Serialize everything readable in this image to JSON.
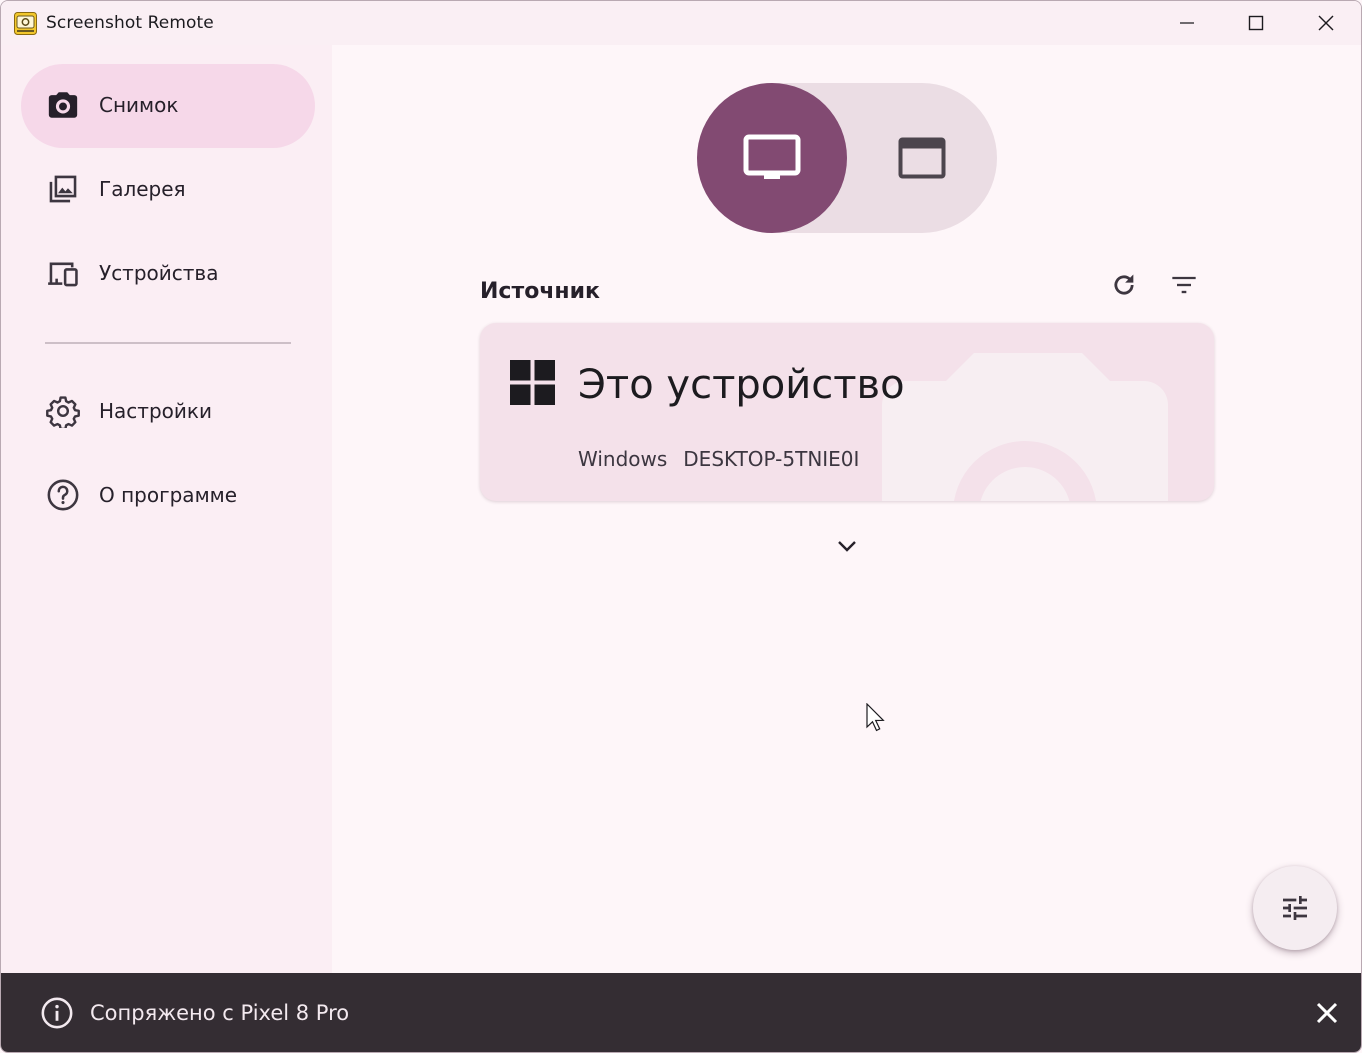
{
  "window": {
    "title": "Screenshot Remote",
    "controls": {
      "minimize": "minimize-icon",
      "maximize": "maximize-icon",
      "close": "close-icon"
    }
  },
  "sidebar": {
    "items": [
      {
        "label": "Снимок",
        "icon": "camera-icon",
        "active": true
      },
      {
        "label": "Галерея",
        "icon": "gallery-icon",
        "active": false
      },
      {
        "label": "Устройства",
        "icon": "devices-icon",
        "active": false
      },
      {
        "label": "Настройки",
        "icon": "gear-icon",
        "active": false
      },
      {
        "label": "О программе",
        "icon": "help-icon",
        "active": false
      }
    ]
  },
  "main": {
    "mode_toggle": {
      "options": [
        "monitor-icon",
        "window-icon"
      ],
      "selected": "monitor-icon"
    },
    "source": {
      "title": "Источник",
      "actions": [
        "refresh-icon",
        "filter-icon"
      ],
      "device": {
        "name": "Это устройство",
        "os": "Windows",
        "hostname": "DESKTOP-5TNIE0I",
        "os_icon": "windows-logo-icon"
      }
    },
    "fab_icon": "tune-icon"
  },
  "snackbar": {
    "message": "Сопряжено с Pixel 8 Pro",
    "icon": "info-icon",
    "close_icon": "close-icon"
  },
  "colors": {
    "accent": "#824a72",
    "active_nav": "#f6d8e9",
    "sidebar_bg": "#fbeef4",
    "card_bg": "#f4e1ea",
    "snackbar_bg": "#342d33"
  }
}
